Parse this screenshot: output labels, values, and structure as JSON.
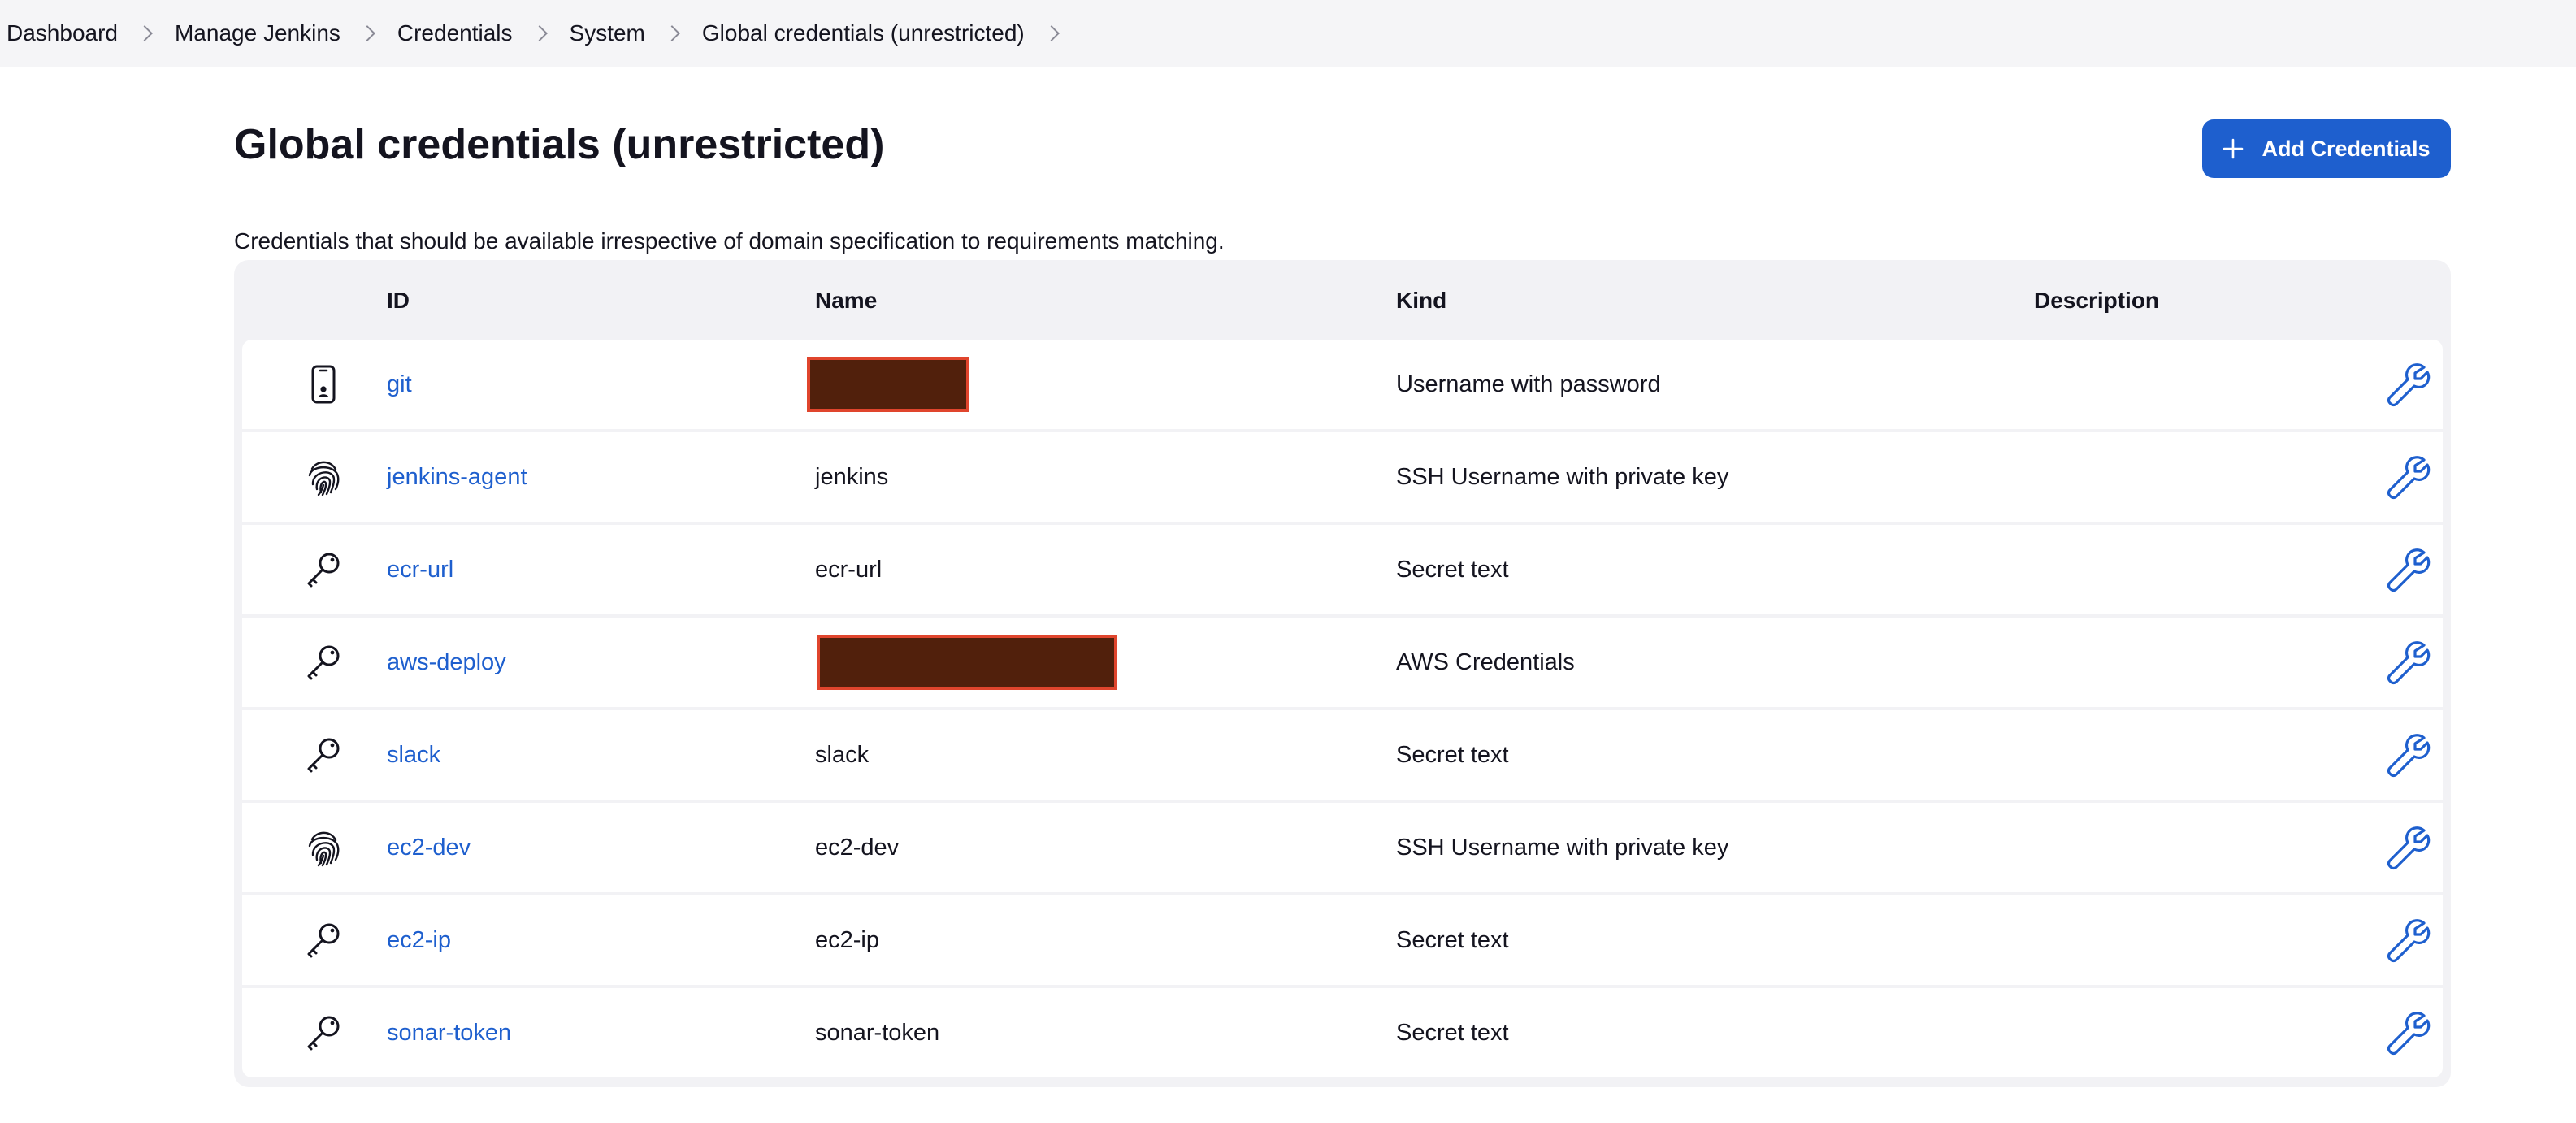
{
  "breadcrumb": {
    "items": [
      {
        "label": "Dashboard"
      },
      {
        "label": "Manage Jenkins"
      },
      {
        "label": "Credentials"
      },
      {
        "label": "System"
      },
      {
        "label": "Global credentials (unrestricted)"
      }
    ]
  },
  "page": {
    "title": "Global credentials (unrestricted)",
    "description": "Credentials that should be available irrespective of domain specification to requirements matching.",
    "add_button_label": "Add Credentials"
  },
  "table": {
    "headers": {
      "id": "ID",
      "name": "Name",
      "kind": "Kind",
      "description": "Description"
    },
    "rows": [
      {
        "icon": "mobile-id-icon",
        "id": "git",
        "name": "",
        "name_redacted": true,
        "kind": "Username with password",
        "description": ""
      },
      {
        "icon": "fingerprint-icon",
        "id": "jenkins-agent",
        "name": "jenkins",
        "name_redacted": false,
        "kind": "SSH Username with private key",
        "description": ""
      },
      {
        "icon": "key-icon",
        "id": "ecr-url",
        "name": "ecr-url",
        "name_redacted": false,
        "kind": "Secret text",
        "description": ""
      },
      {
        "icon": "key-icon",
        "id": "aws-deploy",
        "name": "",
        "name_redacted": true,
        "kind": "AWS Credentials",
        "description": ""
      },
      {
        "icon": "key-icon",
        "id": "slack",
        "name": "slack",
        "name_redacted": false,
        "kind": "Secret text",
        "description": ""
      },
      {
        "icon": "fingerprint-icon",
        "id": "ec2-dev",
        "name": "ec2-dev",
        "name_redacted": false,
        "kind": "SSH Username with private key",
        "description": ""
      },
      {
        "icon": "key-icon",
        "id": "ec2-ip",
        "name": "ec2-ip",
        "name_redacted": false,
        "kind": "Secret text",
        "description": ""
      },
      {
        "icon": "key-icon",
        "id": "sonar-token",
        "name": "sonar-token",
        "name_redacted": false,
        "kind": "Secret text",
        "description": ""
      }
    ]
  },
  "colors": {
    "accent": "#1e5fce",
    "breadcrumb_bg": "#f5f5f7",
    "table_bg": "#f2f2f5",
    "redaction_fill": "#51200c",
    "redaction_border": "#e0452d"
  }
}
